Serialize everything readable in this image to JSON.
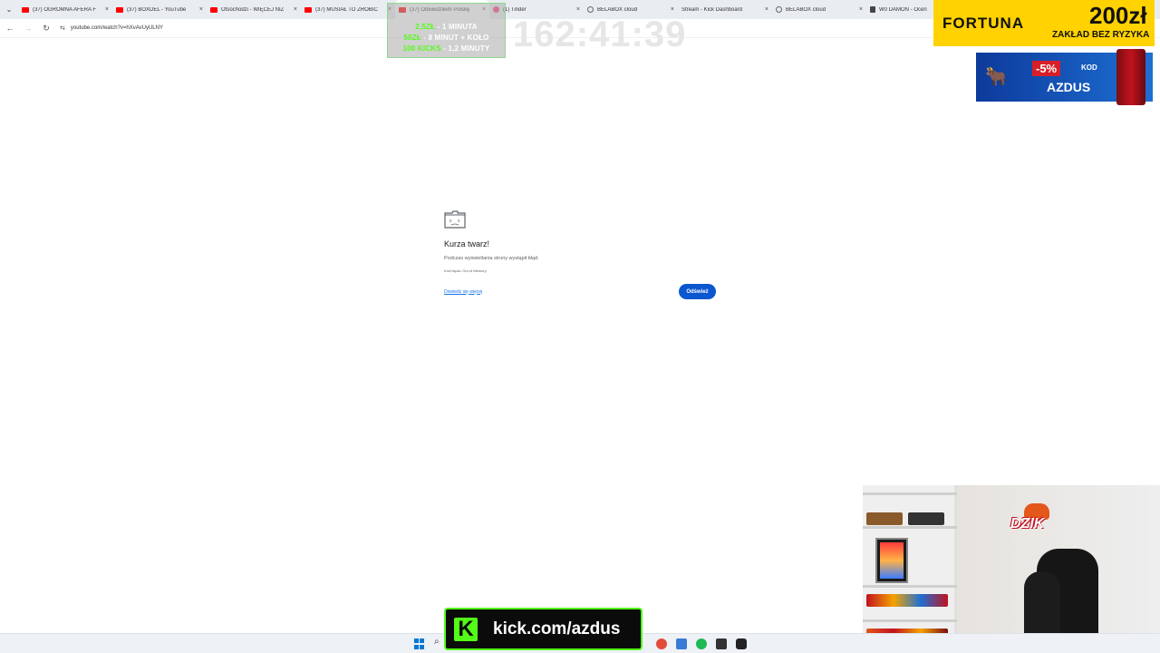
{
  "browser": {
    "tabs": [
      {
        "label": "(37) OGROMNA AFERA F",
        "icon": "youtube-icon",
        "active": false
      },
      {
        "label": "(37) BOXDEL - YouTube",
        "icon": "youtube-icon",
        "active": false
      },
      {
        "label": "Otsochodzi - WIĘCEJ NIŻ",
        "icon": "youtube-icon",
        "active": false
      },
      {
        "label": "(37) MUSIAŁ TO ZROBIĆ",
        "icon": "youtube-icon",
        "active": false
      },
      {
        "label": "(37) Odwiedziłem Polskę",
        "icon": "youtube-icon",
        "active": true
      },
      {
        "label": "(1) Tinder",
        "icon": "tinder-icon",
        "active": false
      },
      {
        "label": "BELABOX cloud",
        "icon": "globe-icon",
        "active": false
      },
      {
        "label": "Stream - Kick Dashboard",
        "icon": "kick-icon",
        "active": false
      },
      {
        "label": "BELABOX cloud",
        "icon": "globe-icon",
        "active": false
      },
      {
        "label": "W0 DAMON - Ocen",
        "icon": "doc-icon",
        "active": false
      }
    ],
    "url": "youtube.com/watch?v=hXvAvUyULNY"
  },
  "crash_page": {
    "title": "Kurza twarz!",
    "description": "Podczas wyświetlania strony wystąpił błąd.",
    "error_code": "Kod błędu: Out of Memory",
    "learn_more": "Dowiedz się więcej",
    "reload": "Odśwież"
  },
  "overlay": {
    "promo": {
      "line1_amount": "2,5ZŁ",
      "line1_rest": " - 1 MINUTA",
      "line2_amount": "50ZŁ",
      "line2_rest": " - 8 MINUT + KOŁO",
      "line3_amount": "100 KICKS",
      "line3_rest": " - 1,2 MINUTY"
    },
    "timer": "162:41:39",
    "fortuna": {
      "logo": "FORTUNA",
      "amount": "200zł",
      "subtitle": "ZAKŁAD BEZ RYZYKA"
    },
    "dzik": {
      "discount": "-5%",
      "kod_label": "KOD",
      "code": "AZDUS"
    },
    "webcam_logo": "DZIK",
    "kick": {
      "url": "kick.com/azdus",
      "k_letter": "K"
    }
  },
  "colors": {
    "kick_green": "#53fc18",
    "chrome_blue": "#0b57d0",
    "fortuna_yellow": "#ffd200"
  }
}
